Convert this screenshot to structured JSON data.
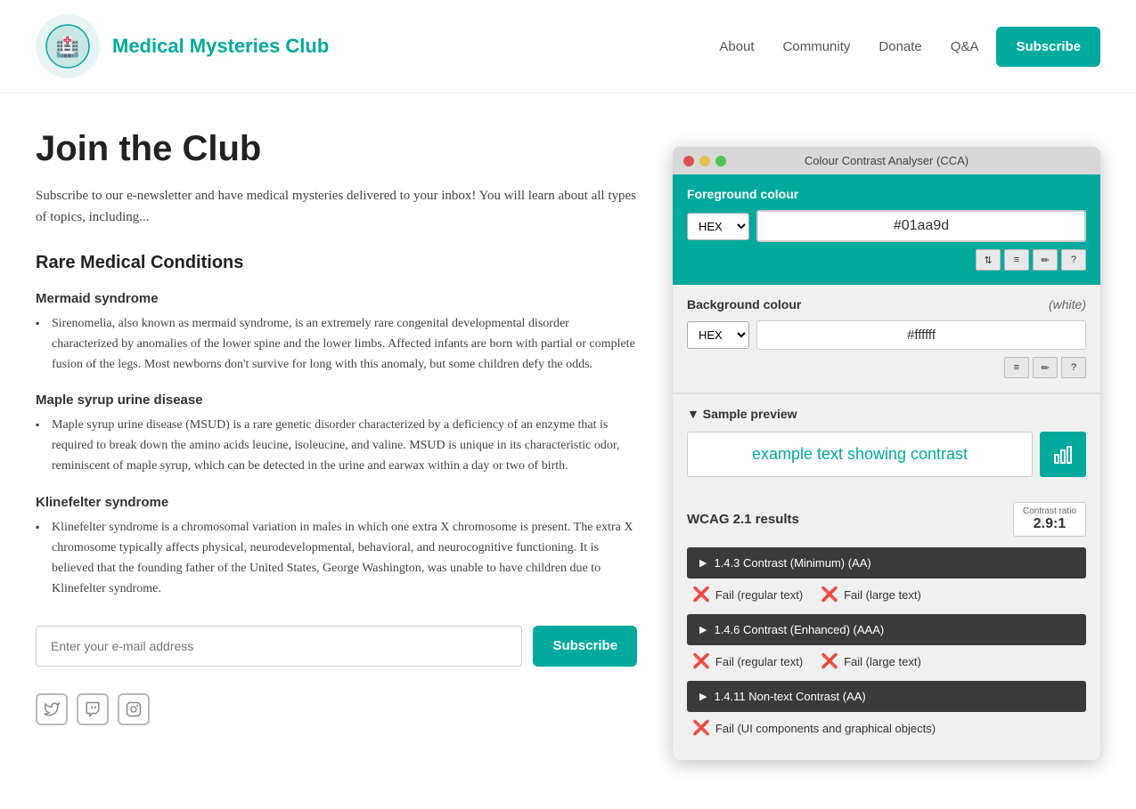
{
  "header": {
    "logo_text": "Medical Mysteries Club",
    "logo_emoji": "🏥",
    "nav": {
      "about": "About",
      "community": "Community",
      "donate": "Donate",
      "qa": "Q&A",
      "subscribe": "Subscribe"
    }
  },
  "main": {
    "page_title": "Join the Club",
    "intro": "Subscribe to our e-newsletter and have medical mysteries delivered to your inbox! You will learn about all types of topics, including...",
    "rare_conditions_heading": "Rare Medical Conditions",
    "conditions": [
      {
        "title": "Mermaid syndrome",
        "body": "Sirenomelia, also known as mermaid syndrome, is an extremely rare congenital developmental disorder characterized by anomalies of the lower spine and the lower limbs. Affected infants are born with partial or complete fusion of the legs. Most newborns don't survive for long with this anomaly, but some children defy the odds."
      },
      {
        "title": "Maple syrup urine disease",
        "body": "Maple syrup urine disease (MSUD) is a rare genetic disorder characterized by a deficiency of an enzyme that is required to break down the amino acids leucine, isoleucine, and valine. MSUD is unique in its characteristic odor, reminiscent of maple syrup, which can be detected in the urine and earwax within a day or two of birth."
      },
      {
        "title": "Klinefelter syndrome",
        "body": "Klinefelter syndrome is a chromosomal variation in males in which one extra X chromosome is present. The extra X chromosome typically affects physical, neurodevelopmental, behavioral, and neurocognitive functioning. It is believed that the founding father of the United States, George Washington, was unable to have children due to Klinefelter syndrome."
      }
    ],
    "email_placeholder": "Enter your e-mail address",
    "subscribe_label": "Subscribe",
    "social": {
      "twitter": "🐦",
      "twitch": "📺",
      "instagram": "📷"
    }
  },
  "cca": {
    "window_title": "Colour Contrast Analyser (CCA)",
    "fg_label": "Foreground colour",
    "fg_format": "HEX",
    "fg_value": "#01aa9d",
    "bg_label": "Background colour",
    "bg_white_label": "(white)",
    "bg_format": "HEX",
    "bg_value": "#ffffff",
    "preview_label": "▼ Sample preview",
    "sample_text": "example text showing contrast",
    "wcag_label": "WCAG 2.1 results",
    "contrast_ratio_label": "Contrast ratio",
    "contrast_ratio_value": "2.9:1",
    "rules": [
      {
        "label": "1.4.3 Contrast (Minimum) (AA)",
        "results": [
          {
            "icon": "❌",
            "text": "Fail (regular text)"
          },
          {
            "icon": "❌",
            "text": "Fail (large text)"
          }
        ]
      },
      {
        "label": "1.4.6 Contrast (Enhanced) (AAA)",
        "results": [
          {
            "icon": "❌",
            "text": "Fail (regular text)"
          },
          {
            "icon": "❌",
            "text": "Fail (large text)"
          }
        ]
      },
      {
        "label": "1.4.11 Non-text Contrast (AA)",
        "results": [
          {
            "icon": "❌",
            "text": "Fail (UI components and graphical objects)"
          }
        ]
      }
    ]
  }
}
